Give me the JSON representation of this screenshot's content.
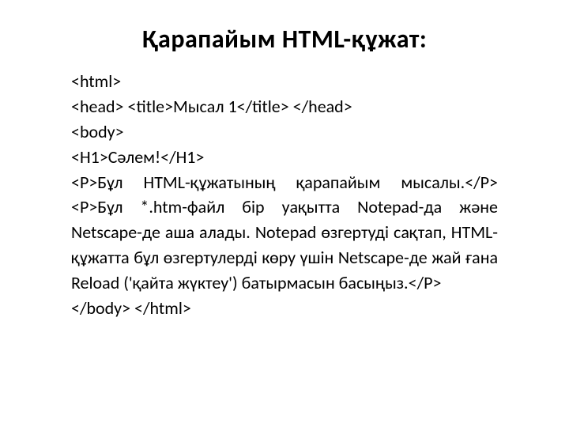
{
  "title": "Қарапайым HTML-құжат:",
  "code": {
    "line1": "<html>",
    "line2": "<head> <title>Мысал 1</title> </head>",
    "line3": " <body>",
    "line4": "<H1>Сәлем!</H1>",
    "para1_open": "<P>",
    "para1_text": "Бұл HTML-құжатының қарапайым мысалы.",
    "para1_close": "</P>",
    "para2_open": " <P>",
    "para2_text": "Бұл *.htm-файл бір уақытта Notepad-да және Netscape-де аша алады. Notepad өзгертуді сақтап, HTML-құжатта бұл өзгертулерді көру үшін Netscape-де жай ғана Reload ('қайта жүктеу') батырмасын басыңыз.",
    "para2_close": "</P>",
    "line_end": " </body> </html>"
  }
}
